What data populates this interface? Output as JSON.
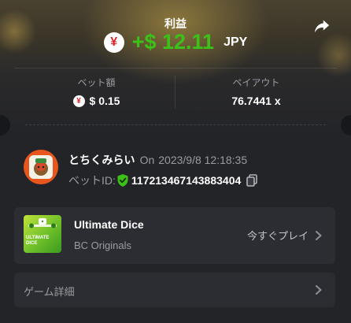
{
  "header": {
    "title": "利益",
    "profit_amount": "+$ 12.11",
    "currency": "JPY",
    "currency_symbol": "¥"
  },
  "stats": {
    "bet_label": "ベット額",
    "bet_value": "$ 0.15",
    "payout_label": "ペイアウト",
    "payout_value": "76.7441 x"
  },
  "player": {
    "username": "とちくみらい",
    "on": "On",
    "datetime": "2023/9/8 12:18:35",
    "bet_id_label": "ベットID:",
    "bet_id": "117213467143883404"
  },
  "game": {
    "name": "Ultimate Dice",
    "provider": "BC Originals",
    "play_label": "今すぐプレイ",
    "thumb_text": "ULTIMATE DICE"
  },
  "details": {
    "label": "ゲーム詳細"
  },
  "colors": {
    "profit": "#3bc117",
    "card": "#232428",
    "panel": "#2c2d32",
    "muted": "#9a9ca1",
    "yen": "#d8262a"
  },
  "icons": [
    "share-icon",
    "yen-icon",
    "shield-check-icon",
    "copy-icon",
    "chevron-right-icon"
  ]
}
